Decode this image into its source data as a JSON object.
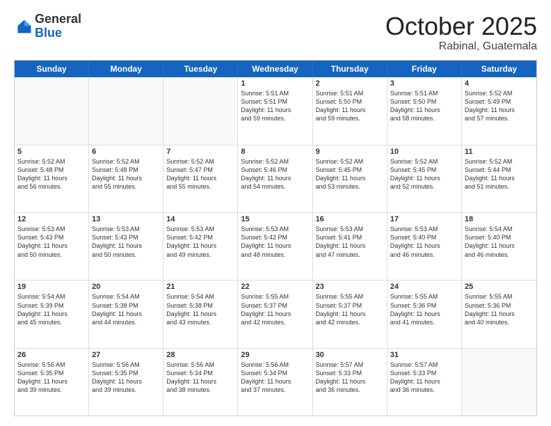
{
  "logo": {
    "general": "General",
    "blue": "Blue"
  },
  "header": {
    "month": "October 2025",
    "location": "Rabinal, Guatemala"
  },
  "days_of_week": [
    "Sunday",
    "Monday",
    "Tuesday",
    "Wednesday",
    "Thursday",
    "Friday",
    "Saturday"
  ],
  "weeks": [
    [
      {
        "day": "",
        "info": "",
        "empty": true
      },
      {
        "day": "",
        "info": "",
        "empty": true
      },
      {
        "day": "",
        "info": "",
        "empty": true
      },
      {
        "day": "1",
        "info": "Sunrise: 5:51 AM\nSunset: 5:51 PM\nDaylight: 11 hours\nand 59 minutes."
      },
      {
        "day": "2",
        "info": "Sunrise: 5:51 AM\nSunset: 5:50 PM\nDaylight: 11 hours\nand 59 minutes."
      },
      {
        "day": "3",
        "info": "Sunrise: 5:51 AM\nSunset: 5:50 PM\nDaylight: 11 hours\nand 58 minutes."
      },
      {
        "day": "4",
        "info": "Sunrise: 5:52 AM\nSunset: 5:49 PM\nDaylight: 11 hours\nand 57 minutes."
      }
    ],
    [
      {
        "day": "5",
        "info": "Sunrise: 5:52 AM\nSunset: 5:48 PM\nDaylight: 11 hours\nand 56 minutes."
      },
      {
        "day": "6",
        "info": "Sunrise: 5:52 AM\nSunset: 5:48 PM\nDaylight: 11 hours\nand 55 minutes."
      },
      {
        "day": "7",
        "info": "Sunrise: 5:52 AM\nSunset: 5:47 PM\nDaylight: 11 hours\nand 55 minutes."
      },
      {
        "day": "8",
        "info": "Sunrise: 5:52 AM\nSunset: 5:46 PM\nDaylight: 11 hours\nand 54 minutes."
      },
      {
        "day": "9",
        "info": "Sunrise: 5:52 AM\nSunset: 5:45 PM\nDaylight: 11 hours\nand 53 minutes."
      },
      {
        "day": "10",
        "info": "Sunrise: 5:52 AM\nSunset: 5:45 PM\nDaylight: 11 hours\nand 52 minutes."
      },
      {
        "day": "11",
        "info": "Sunrise: 5:52 AM\nSunset: 5:44 PM\nDaylight: 11 hours\nand 51 minutes."
      }
    ],
    [
      {
        "day": "12",
        "info": "Sunrise: 5:53 AM\nSunset: 5:43 PM\nDaylight: 11 hours\nand 50 minutes."
      },
      {
        "day": "13",
        "info": "Sunrise: 5:53 AM\nSunset: 5:43 PM\nDaylight: 11 hours\nand 50 minutes."
      },
      {
        "day": "14",
        "info": "Sunrise: 5:53 AM\nSunset: 5:42 PM\nDaylight: 11 hours\nand 49 minutes."
      },
      {
        "day": "15",
        "info": "Sunrise: 5:53 AM\nSunset: 5:42 PM\nDaylight: 11 hours\nand 48 minutes."
      },
      {
        "day": "16",
        "info": "Sunrise: 5:53 AM\nSunset: 5:41 PM\nDaylight: 11 hours\nand 47 minutes."
      },
      {
        "day": "17",
        "info": "Sunrise: 5:53 AM\nSunset: 5:40 PM\nDaylight: 11 hours\nand 46 minutes."
      },
      {
        "day": "18",
        "info": "Sunrise: 5:54 AM\nSunset: 5:40 PM\nDaylight: 11 hours\nand 46 minutes."
      }
    ],
    [
      {
        "day": "19",
        "info": "Sunrise: 5:54 AM\nSunset: 5:39 PM\nDaylight: 11 hours\nand 45 minutes."
      },
      {
        "day": "20",
        "info": "Sunrise: 5:54 AM\nSunset: 5:38 PM\nDaylight: 11 hours\nand 44 minutes."
      },
      {
        "day": "21",
        "info": "Sunrise: 5:54 AM\nSunset: 5:38 PM\nDaylight: 11 hours\nand 43 minutes."
      },
      {
        "day": "22",
        "info": "Sunrise: 5:55 AM\nSunset: 5:37 PM\nDaylight: 11 hours\nand 42 minutes."
      },
      {
        "day": "23",
        "info": "Sunrise: 5:55 AM\nSunset: 5:37 PM\nDaylight: 11 hours\nand 42 minutes."
      },
      {
        "day": "24",
        "info": "Sunrise: 5:55 AM\nSunset: 5:36 PM\nDaylight: 11 hours\nand 41 minutes."
      },
      {
        "day": "25",
        "info": "Sunrise: 5:55 AM\nSunset: 5:36 PM\nDaylight: 11 hours\nand 40 minutes."
      }
    ],
    [
      {
        "day": "26",
        "info": "Sunrise: 5:56 AM\nSunset: 5:35 PM\nDaylight: 11 hours\nand 39 minutes."
      },
      {
        "day": "27",
        "info": "Sunrise: 5:56 AM\nSunset: 5:35 PM\nDaylight: 11 hours\nand 39 minutes."
      },
      {
        "day": "28",
        "info": "Sunrise: 5:56 AM\nSunset: 5:34 PM\nDaylight: 11 hours\nand 38 minutes."
      },
      {
        "day": "29",
        "info": "Sunrise: 5:56 AM\nSunset: 5:34 PM\nDaylight: 11 hours\nand 37 minutes."
      },
      {
        "day": "30",
        "info": "Sunrise: 5:57 AM\nSunset: 5:33 PM\nDaylight: 11 hours\nand 36 minutes."
      },
      {
        "day": "31",
        "info": "Sunrise: 5:57 AM\nSunset: 5:33 PM\nDaylight: 11 hours\nand 36 minutes."
      },
      {
        "day": "",
        "info": "",
        "empty": true
      }
    ]
  ]
}
